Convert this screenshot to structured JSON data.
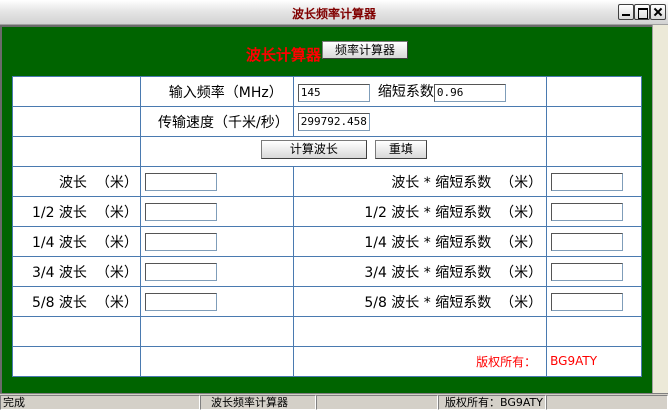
{
  "window": {
    "title": "波长频率计算器"
  },
  "header": {
    "heading": "波长计算器",
    "switch_button": "频率计算器"
  },
  "form": {
    "freq_label": "输入频率（MHz）",
    "freq_value": "145",
    "shorten_label": "缩短系数",
    "shorten_value": "0.96",
    "speed_label": "传输速度（千米/秒）",
    "speed_value": "299792.458",
    "calc_button": "计算波长",
    "reset_button": "重填"
  },
  "rows": [
    {
      "left_label": "波长  （米）",
      "right_label": "波长 * 缩短系数  （米）"
    },
    {
      "left_label": "1/2 波长  （米）",
      "right_label": "1/2 波长 * 缩短系数  （米）"
    },
    {
      "left_label": "1/4 波长  （米）",
      "right_label": "1/4 波长 * 缩短系数  （米）"
    },
    {
      "left_label": "3/4 波长  （米）",
      "right_label": "3/4 波长 * 缩短系数  （米）"
    },
    {
      "left_label": "5/8 波长  （米）",
      "right_label": "5/8 波长 * 缩短系数  （米）"
    }
  ],
  "copyright": {
    "label": "版权所有：",
    "owner": "BG9ATY"
  },
  "status": {
    "left": "完成",
    "middle": "波长频率计算器",
    "right": "版权所有：BG9ATY"
  }
}
